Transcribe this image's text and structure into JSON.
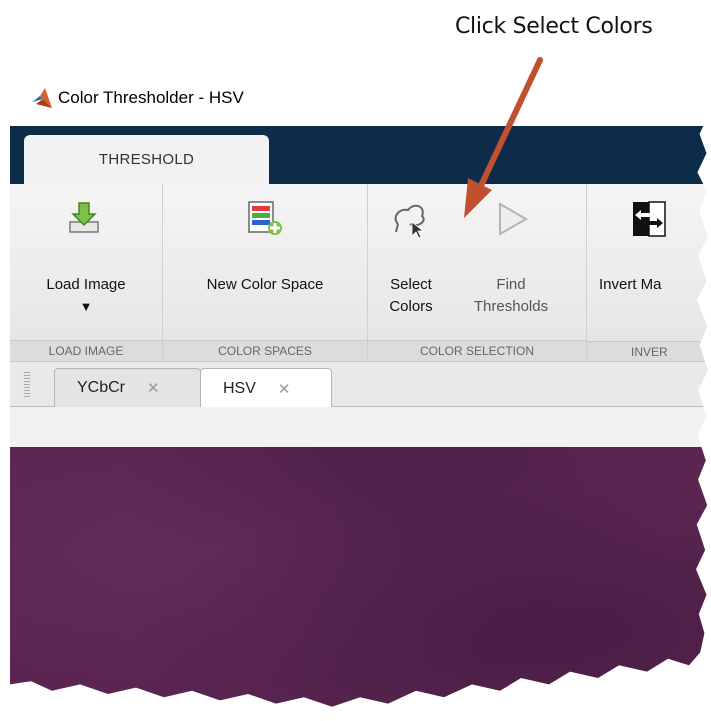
{
  "annotation": {
    "callout_text": "Click Select Colors",
    "arrow_color": "#c1502e"
  },
  "window": {
    "title": "Color Thresholder - HSV"
  },
  "ribbon_tabs": [
    {
      "label": "THRESHOLD"
    }
  ],
  "ribbon": {
    "sections": [
      {
        "label": "LOAD IMAGE"
      },
      {
        "label": "COLOR SPACES"
      },
      {
        "label": "COLOR SELECTION"
      },
      {
        "label": "INVER"
      }
    ],
    "buttons": {
      "load_image": {
        "label": "Load Image",
        "icon": "load-image-icon"
      },
      "new_color_space": {
        "label": "New Color Space",
        "icon": "new-color-space-icon"
      },
      "select_colors": {
        "line1": "Select",
        "line2": "Colors",
        "icon": "freehand-select-icon"
      },
      "find_thresholds": {
        "line1": "Find",
        "line2": "Thresholds",
        "icon": "play-icon",
        "disabled": true
      },
      "invert_mask": {
        "label": "Invert Ma",
        "icon": "invert-mask-icon"
      }
    }
  },
  "doc_tabs": [
    {
      "label": "YCbCr",
      "active": false
    },
    {
      "label": "HSV",
      "active": true
    }
  ],
  "colors": {
    "title_bar_dark": "#0c2c49",
    "image_purple": "#5a2651"
  }
}
